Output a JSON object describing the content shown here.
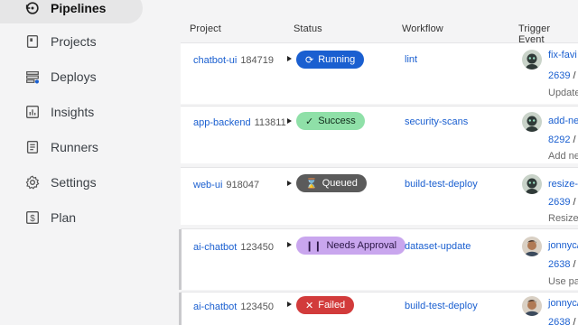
{
  "sidebar": {
    "active": {
      "label": "Pipelines",
      "icon": "pipelines-icon"
    },
    "items": [
      {
        "label": "Projects",
        "icon": "projects-icon"
      },
      {
        "label": "Deploys",
        "icon": "deploys-icon"
      },
      {
        "label": "Insights",
        "icon": "insights-icon"
      },
      {
        "label": "Runners",
        "icon": "runners-icon"
      },
      {
        "label": "Settings",
        "icon": "gear-icon"
      },
      {
        "label": "Plan",
        "icon": "plan-icon"
      }
    ]
  },
  "table": {
    "headers": {
      "project": "Project",
      "status": "Status",
      "workflow": "Workflow",
      "trigger": "Trigger Event"
    },
    "rows": [
      {
        "project": "chatbot-ui",
        "project_id": "184719",
        "status": "Running",
        "status_icon": "running-icon",
        "workflow": "lint",
        "trigger_title": "fix-favi",
        "trigger_num": "2639",
        "trigger_sep": "/",
        "trigger_msg": "Update"
      },
      {
        "project": "app-backend",
        "project_id": "113811",
        "status": "Success",
        "status_icon": "check-icon",
        "workflow": "security-scans",
        "trigger_title": "add-ne",
        "trigger_num": "8292",
        "trigger_sep": "/",
        "trigger_msg": "Add ne"
      },
      {
        "project": "web-ui",
        "project_id": "918047",
        "status": "Queued",
        "status_icon": "hourglass-icon",
        "workflow": "build-test-deploy",
        "trigger_title": "resize-i",
        "trigger_num": "2639",
        "trigger_sep": "/",
        "trigger_msg": "Resize"
      },
      {
        "project": "ai-chatbot",
        "project_id": "123450",
        "status": "Needs Approval",
        "status_icon": "pause-icon",
        "workflow": "dataset-update",
        "trigger_title": "jonnyc/",
        "trigger_num": "2638",
        "trigger_sep": "/",
        "trigger_msg": "Use pa"
      },
      {
        "project": "ai-chatbot",
        "project_id": "123450",
        "status": "Failed",
        "status_icon": "x-icon",
        "workflow": "build-test-deploy",
        "trigger_title": "jonnyc/",
        "trigger_num": "2638",
        "trigger_sep": "/",
        "trigger_msg": ""
      }
    ]
  },
  "colors": {
    "link": "#1a5fd0",
    "running": "#1a5fd0",
    "success": "#8fe0a8",
    "queued": "#5b5b5b",
    "approval": "#c9a6ee",
    "failed": "#d23b3b"
  }
}
